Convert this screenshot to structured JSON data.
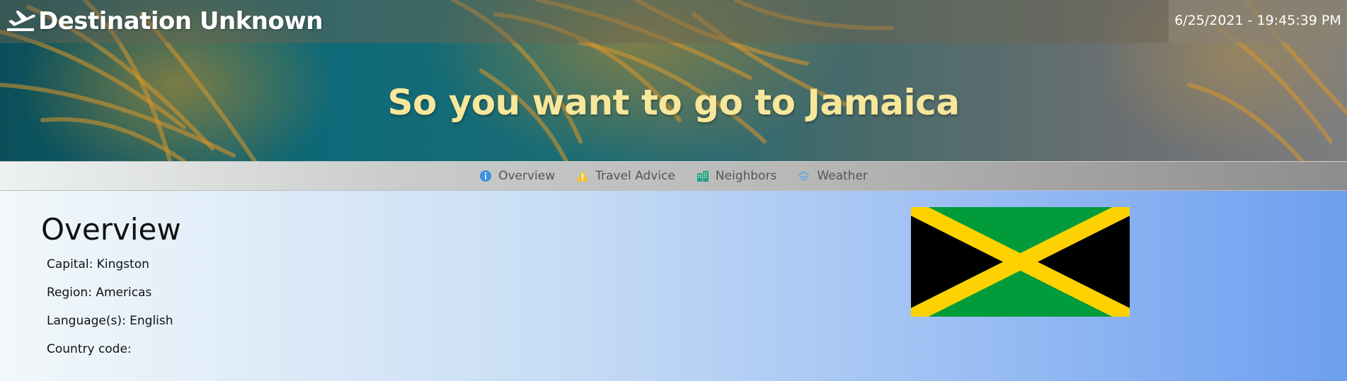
{
  "app": {
    "brand": "Destination Unknown",
    "clock": "6/25/2021 - 19:45:39 PM"
  },
  "hero": {
    "title": "So you want to go to Jamaica"
  },
  "tabs": [
    {
      "label": "Overview",
      "icon": "info-icon",
      "color": "#3b8fe0"
    },
    {
      "label": "Travel Advice",
      "icon": "warning-icon",
      "color": "#f2c230"
    },
    {
      "label": "Neighbors",
      "icon": "buildings-icon",
      "color": "#22a083"
    },
    {
      "label": "Weather",
      "icon": "cloud-rain-icon",
      "color": "#5aa6e6"
    }
  ],
  "overview": {
    "title": "Overview",
    "facts": [
      "Capital: Kingston",
      "Region: Americas",
      "Language(s): English",
      "Country code:"
    ]
  },
  "flag": {
    "country": "Jamaica",
    "colors": {
      "green": "#009b3a",
      "gold": "#fed100",
      "black": "#000000"
    }
  }
}
